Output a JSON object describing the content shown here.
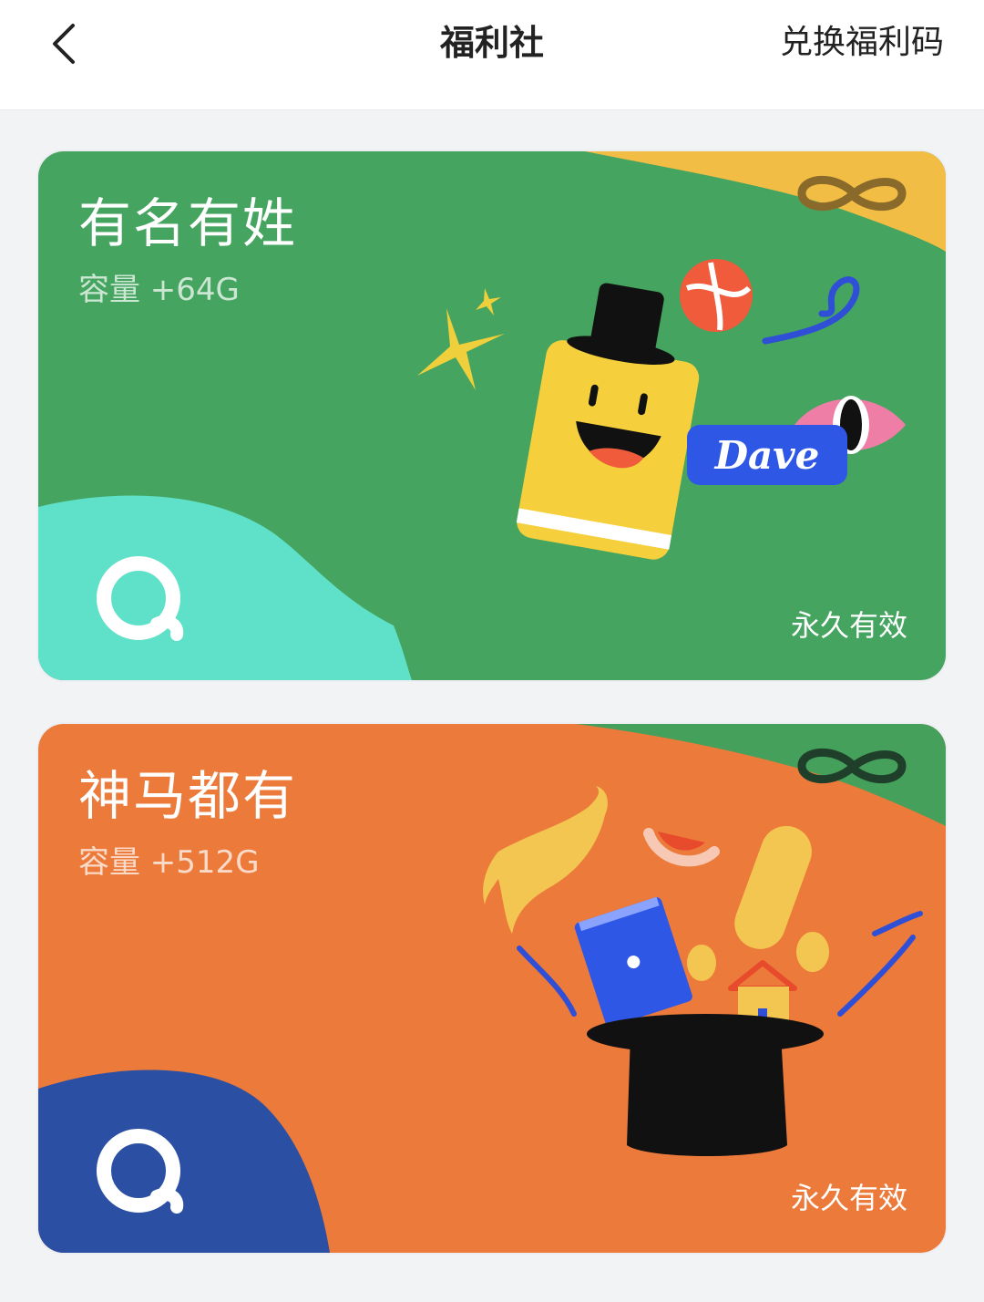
{
  "header": {
    "back_icon": "chevron-left-icon",
    "title": "福利社",
    "redeem_label": "兑换福利码"
  },
  "cards": [
    {
      "name": "有名有姓",
      "capacity": "容量 +64G",
      "validity": "永久有效",
      "badge_label": "Dave",
      "background_color": "#45a45f",
      "corner_color": "#f2bd45",
      "blob_color": "#5fe0c8",
      "infinity_icon": "infinity-icon",
      "logo_icon": "app-logo-icon"
    },
    {
      "name": "神马都有",
      "capacity": "容量 +512G",
      "validity": "永久有效",
      "background_color": "#ec7a3a",
      "corner_color": "#44a05a",
      "blob_color": "#2a4fa3",
      "infinity_icon": "infinity-icon",
      "logo_icon": "app-logo-icon"
    }
  ]
}
